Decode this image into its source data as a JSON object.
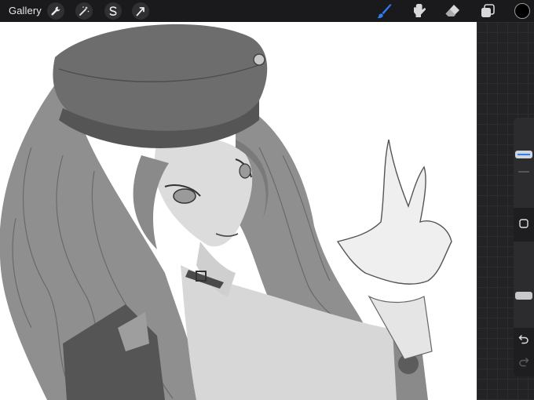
{
  "toolbar": {
    "gallery_label": "Gallery",
    "left_tools": [
      {
        "icon": "wrench-icon",
        "name": "actions"
      },
      {
        "icon": "magic-wand-icon",
        "name": "adjustments"
      },
      {
        "icon": "selection-s-icon",
        "name": "selection"
      },
      {
        "icon": "transform-arrow-icon",
        "name": "transform"
      }
    ],
    "right_tools": [
      {
        "icon": "brush-icon",
        "name": "paint",
        "active": true
      },
      {
        "icon": "smudge-icon",
        "name": "smudge",
        "active": false
      },
      {
        "icon": "eraser-icon",
        "name": "eraser",
        "active": false
      },
      {
        "icon": "layers-icon",
        "name": "layers",
        "active": false
      }
    ],
    "current_color": "#000000",
    "active_tool_color": "#2e7cf6"
  },
  "sidebar": {
    "brush_size_level": 0.6,
    "opacity_level": 0.35,
    "modify_icon": "square-icon",
    "undo_icon": "undo-arrow-icon",
    "redo_icon": "redo-arrow-icon"
  }
}
